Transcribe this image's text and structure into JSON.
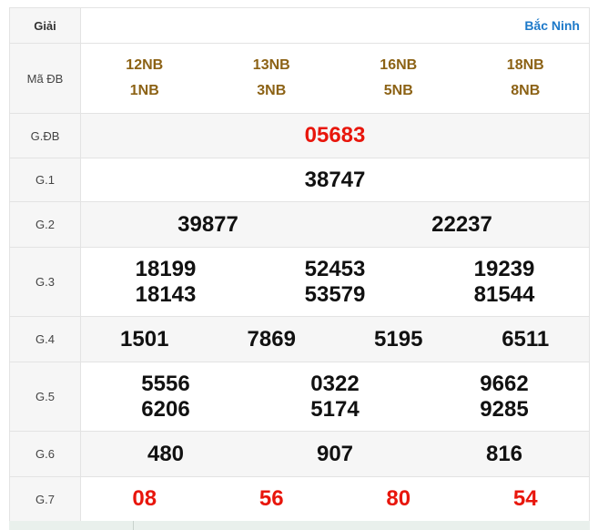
{
  "header": {
    "label": "Giải",
    "province": "Bắc Ninh"
  },
  "ma_db": {
    "label": "Mã ĐB",
    "codes": [
      [
        "12NB",
        "1NB"
      ],
      [
        "13NB",
        "3NB"
      ],
      [
        "16NB",
        "5NB"
      ],
      [
        "18NB",
        "8NB"
      ]
    ]
  },
  "prizes": [
    {
      "label": "G.ĐB",
      "values": [
        [
          "05683"
        ]
      ],
      "accent": true
    },
    {
      "label": "G.1",
      "values": [
        [
          "38747"
        ]
      ]
    },
    {
      "label": "G.2",
      "values": [
        [
          "39877"
        ],
        [
          "22237"
        ]
      ]
    },
    {
      "label": "G.3",
      "values": [
        [
          "18199",
          "18143"
        ],
        [
          "52453",
          "53579"
        ],
        [
          "19239",
          "81544"
        ]
      ]
    },
    {
      "label": "G.4",
      "values": [
        [
          "1501"
        ],
        [
          "7869"
        ],
        [
          "5195"
        ],
        [
          "6511"
        ]
      ]
    },
    {
      "label": "G.5",
      "values": [
        [
          "5556",
          "6206"
        ],
        [
          "0322",
          "5174"
        ],
        [
          "9662",
          "9285"
        ]
      ]
    },
    {
      "label": "G.6",
      "values": [
        [
          "480"
        ],
        [
          "907"
        ],
        [
          "816"
        ]
      ]
    },
    {
      "label": "G.7",
      "values": [
        [
          "08"
        ],
        [
          "56"
        ],
        [
          "80"
        ],
        [
          "54"
        ]
      ],
      "accent": true
    }
  ],
  "colors": {
    "accent_red": "#e8160c",
    "code_brown": "#8c6215",
    "province_blue": "#1d79c9",
    "row_alt": "#f6f6f6"
  }
}
